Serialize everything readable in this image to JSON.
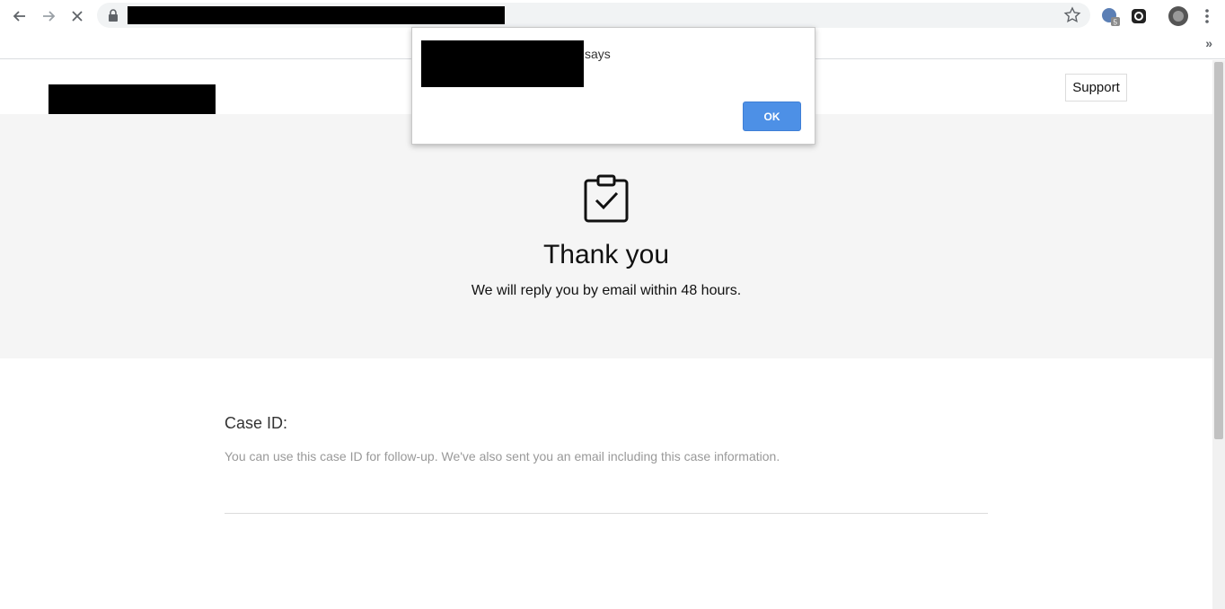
{
  "browser": {
    "address_bar": {
      "url_redacted": true
    },
    "icons": [
      "back-icon",
      "forward-icon",
      "stop-loading-icon",
      "lock-icon",
      "star-icon",
      "extension-icon",
      "extension-icon-2",
      "profile-avatar",
      "menu-icon"
    ],
    "more_bookmarks_label": "»"
  },
  "header": {
    "support_label": "Support"
  },
  "hero": {
    "title": "Thank you",
    "subtitle": "We will reply you by email within 48 hours.",
    "icon": "clipboard-check-icon"
  },
  "case": {
    "label": "Case ID:",
    "description": "You can use this case ID for follow-up. We've also sent you an email including this case information."
  },
  "dialog": {
    "says_text": "says",
    "ok_label": "OK"
  },
  "colors": {
    "hero_background": "#f5f5f5",
    "ok_button": "#4d90e6",
    "muted_text": "#999999"
  }
}
